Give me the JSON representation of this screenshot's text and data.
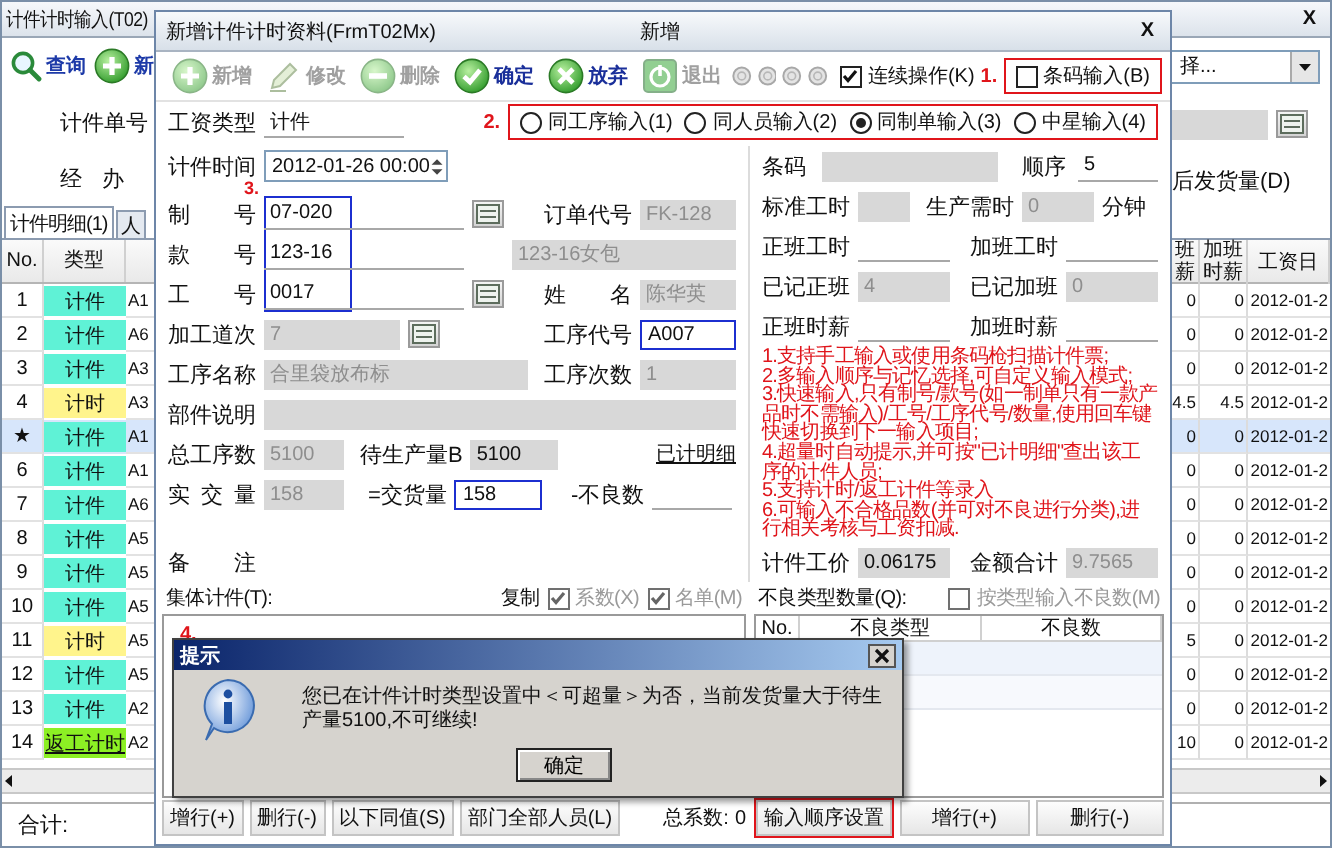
{
  "main_window": {
    "title": "计件计时输入(T02)",
    "close": "X",
    "toolbar": [
      {
        "label": "查询"
      },
      {
        "label": "新"
      }
    ],
    "filter_dropdown": {
      "value": "择..."
    },
    "fields": [
      {
        "label": "计件单号"
      },
      {
        "label": "经 办"
      }
    ],
    "delivery_label": "后发货量(D)",
    "tabs": [
      {
        "label": "计件明细(1)",
        "selected": true
      },
      {
        "label": "人",
        "selected": false
      }
    ],
    "left_table": {
      "columns": [
        "No.",
        "类型"
      ],
      "rows": [
        {
          "no": "1",
          "type": "计件",
          "kind": "piece",
          "code": "A1",
          "selected": false
        },
        {
          "no": "2",
          "type": "计件",
          "kind": "piece",
          "code": "A6",
          "selected": false
        },
        {
          "no": "3",
          "type": "计件",
          "kind": "piece",
          "code": "A3",
          "selected": false
        },
        {
          "no": "4",
          "type": "计时",
          "kind": "time",
          "code": "A3",
          "selected": false
        },
        {
          "no": "★",
          "type": "计件",
          "kind": "piece",
          "code": "A1",
          "selected": true
        },
        {
          "no": "6",
          "type": "计件",
          "kind": "piece",
          "code": "A1",
          "selected": false
        },
        {
          "no": "7",
          "type": "计件",
          "kind": "piece",
          "code": "A6",
          "selected": false
        },
        {
          "no": "8",
          "type": "计件",
          "kind": "piece",
          "code": "A5",
          "selected": false
        },
        {
          "no": "9",
          "type": "计件",
          "kind": "piece",
          "code": "A5",
          "selected": false
        },
        {
          "no": "10",
          "type": "计件",
          "kind": "piece",
          "code": "A5",
          "selected": false
        },
        {
          "no": "11",
          "type": "计时",
          "kind": "time",
          "code": "A5",
          "selected": false
        },
        {
          "no": "12",
          "type": "计件",
          "kind": "piece",
          "code": "A5",
          "selected": false
        },
        {
          "no": "13",
          "type": "计件",
          "kind": "piece",
          "code": "A2",
          "selected": false
        },
        {
          "no": "14",
          "type": "返工计时",
          "kind": "rework",
          "code": "A2",
          "selected": false
        }
      ]
    },
    "right_table": {
      "columns": [
        {
          "lines": [
            "班",
            "薪"
          ]
        },
        {
          "lines": [
            "加班",
            "时薪"
          ]
        },
        {
          "lines": [
            "工资日"
          ]
        }
      ],
      "rows": [
        {
          "values": [
            "0",
            "0",
            "2012-01-2"
          ],
          "selected": false
        },
        {
          "values": [
            "0",
            "0",
            "2012-01-2"
          ],
          "selected": false
        },
        {
          "values": [
            "0",
            "0",
            "2012-01-2"
          ],
          "selected": false
        },
        {
          "values": [
            "4.5",
            "4.5",
            "2012-01-2"
          ],
          "selected": false
        },
        {
          "values": [
            "0",
            "0",
            "2012-01-2"
          ],
          "selected": true
        },
        {
          "values": [
            "0",
            "0",
            "2012-01-2"
          ],
          "selected": false
        },
        {
          "values": [
            "0",
            "0",
            "2012-01-2"
          ],
          "selected": false
        },
        {
          "values": [
            "0",
            "0",
            "2012-01-2"
          ],
          "selected": false
        },
        {
          "values": [
            "0",
            "0",
            "2012-01-2"
          ],
          "selected": false
        },
        {
          "values": [
            "0",
            "0",
            "2012-01-2"
          ],
          "selected": false
        },
        {
          "values": [
            "5",
            "0",
            "2012-01-2"
          ],
          "selected": false
        },
        {
          "values": [
            "0",
            "0",
            "2012-01-2"
          ],
          "selected": false
        },
        {
          "values": [
            "0",
            "0",
            "2012-01-2"
          ],
          "selected": false
        },
        {
          "values": [
            "10",
            "0",
            "2012-01-2"
          ],
          "selected": false
        }
      ]
    },
    "total_label": "合计:"
  },
  "dialog": {
    "title": "新增计件计时资料(FrmT02Mx)",
    "caption": "新增",
    "close": "X",
    "toolbar": [
      {
        "label": "新增",
        "disabled": true
      },
      {
        "label": "修改",
        "disabled": true
      },
      {
        "label": "删除",
        "disabled": true
      },
      {
        "label": "确定",
        "disabled": false
      },
      {
        "label": "放弃",
        "disabled": false
      },
      {
        "label": "退出",
        "disabled": true
      }
    ],
    "continuous": {
      "label": "连续操作(K)",
      "checked": true
    },
    "barcode_option": {
      "marker": "1.",
      "label": "条码输入(B)",
      "checked": false
    },
    "wage_type": {
      "label": "工资类型",
      "value": "计件"
    },
    "input_mode": {
      "marker": "2.",
      "options": [
        {
          "label": "同工序输入(1)",
          "selected": false
        },
        {
          "label": "同人员输入(2)",
          "selected": false
        },
        {
          "label": "同制单输入(3)",
          "selected": true
        },
        {
          "label": "中星输入(4)",
          "selected": false
        }
      ]
    },
    "form": {
      "time": {
        "label": "计件时间",
        "value": "2012-01-26 00:00"
      },
      "key_group": {
        "marker": "3.",
        "highlighted": true
      },
      "order_no": {
        "label": "制 号",
        "value": "07-020"
      },
      "order_code": {
        "label": "订单代号",
        "value": "FK-128",
        "disabled": true
      },
      "style_no": {
        "label": "款 号",
        "value": "123-16"
      },
      "style_name": {
        "value": "123-16女包",
        "disabled": true
      },
      "worker_no": {
        "label": "工 号",
        "value": "0017"
      },
      "worker_name": {
        "label": "姓 名",
        "value": "陈华英",
        "disabled": true
      },
      "pass_no": {
        "label": "加工道次",
        "value": "7",
        "disabled": true
      },
      "process_code": {
        "label": "工序代号",
        "value": "A007",
        "highlighted": true
      },
      "process_name": {
        "label": "工序名称",
        "value": "合里袋放布标",
        "disabled": true
      },
      "process_count": {
        "label": "工序次数",
        "value": "1",
        "disabled": true
      },
      "part_desc": {
        "label": "部件说明",
        "disabled": true
      },
      "total_process": {
        "label": "总工序数",
        "value": "5100",
        "disabled": true
      },
      "pending": {
        "label": "待生产量B",
        "value": "5100",
        "readonly": true
      },
      "detail_link": "已计明细",
      "actual": {
        "label": "实 交 量",
        "value": "158",
        "disabled": true
      },
      "delivered": {
        "label": "=交货量",
        "value": "158",
        "highlighted": true
      },
      "defect_count": {
        "label": "-不良数"
      },
      "remark": {
        "label": "备 注"
      },
      "barcode": {
        "label": "条码",
        "disabled": true
      },
      "sequence": {
        "label": "顺序",
        "value": "5"
      },
      "std_hours": {
        "label": "标准工时",
        "disabled": true
      },
      "prod_time": {
        "label": "生产需时",
        "value": "0",
        "unit": "分钟",
        "disabled": true
      },
      "regular_hours": {
        "label": "正班工时"
      },
      "overtime_hours": {
        "label": "加班工时"
      },
      "logged_regular": {
        "label": "已记正班",
        "value": "4",
        "disabled": true
      },
      "logged_overtime": {
        "label": "已记加班",
        "value": "0",
        "disabled": true
      },
      "regular_rate": {
        "label": "正班时薪"
      },
      "overtime_rate": {
        "label": "加班时薪"
      },
      "notes": [
        "1.支持手工输入或使用条码枪扫描计件票;",
        "2.多输入顺序与记忆选择,可自定义输入模式;",
        "3.快速输入,只有制号/款号(如一制单只有一款产品时不需输入)/工号/工序代号/数量,使用回车键快速切换到下一输入项目;",
        "4.超量时自动提示,并可按\"已计明细\"查出该工序的计件人员;",
        "5.支持计时/返工计件等录入",
        "6.可输入不合格品数(并可对不良进行分类),进行相关考核与工资扣减."
      ],
      "unit_price": {
        "label": "计件工价",
        "value": "0.06175",
        "readonly": true
      },
      "amount": {
        "label": "金额合计",
        "value": "9.7565",
        "disabled": true
      }
    },
    "group_piece": {
      "label": "集体计件(T):",
      "copy_label": "复制",
      "marker": "4.",
      "options": [
        {
          "label": "系数(X)",
          "checked": true,
          "disabled": true
        },
        {
          "label": "名单(M)",
          "checked": true,
          "disabled": true
        }
      ]
    },
    "defects": {
      "label": "不良类型数量(Q):",
      "by_type": {
        "label": "按类型输入不良数(M)",
        "checked": false,
        "disabled": true
      },
      "columns": [
        "No.",
        "不良类型",
        "不良数"
      ]
    },
    "left_buttons": [
      "增行(+)",
      "删行(-)",
      "以下同值(S)",
      "部门全部人员(L)"
    ],
    "total_coef": {
      "label": "总系数:",
      "value": "0"
    },
    "sequence_button": {
      "label": "输入顺序设置",
      "highlighted": true
    },
    "right_buttons": [
      "增行(+)",
      "删行(-)"
    ],
    "message_box": {
      "title": "提示",
      "text": "您已在计件计时类型设置中＜可超量＞为否，当前发货量大于待生产量5100,不可继续!",
      "button": "确定"
    }
  }
}
